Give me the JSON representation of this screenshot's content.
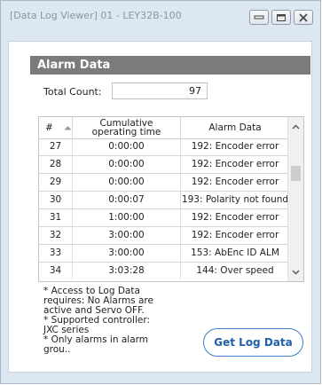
{
  "window": {
    "title": "[Data Log Viewer] 01 - LEY32B-100"
  },
  "section": {
    "title": "Alarm Data"
  },
  "total": {
    "label": "Total Count:",
    "value": "97"
  },
  "table": {
    "columns": [
      "#",
      "Cumulative operating time",
      "Alarm Data"
    ],
    "rows": [
      {
        "num": "27",
        "time": "0:00:00",
        "alarm": "192: Encoder error"
      },
      {
        "num": "28",
        "time": "0:00:00",
        "alarm": "192: Encoder error"
      },
      {
        "num": "29",
        "time": "0:00:00",
        "alarm": "192: Encoder error"
      },
      {
        "num": "30",
        "time": "0:00:07",
        "alarm": "193: Polarity not found"
      },
      {
        "num": "31",
        "time": "1:00:00",
        "alarm": "192: Encoder error"
      },
      {
        "num": "32",
        "time": "3:00:00",
        "alarm": "192: Encoder error"
      },
      {
        "num": "33",
        "time": "3:00:00",
        "alarm": "153: AbEnc ID ALM"
      },
      {
        "num": "34",
        "time": "3:03:28",
        "alarm": "144: Over speed"
      }
    ]
  },
  "notes": [
    "* Access to Log Data requires: No Alarms are active and Servo OFF.",
    "* Supported controller: JXC series",
    "* Only alarms in alarm grou.."
  ],
  "buttons": {
    "get_log": "Get Log Data"
  },
  "icons": {
    "minimize": "minimize-icon",
    "maximize": "maximize-icon",
    "close": "close-icon",
    "sort": "sort-up-icon",
    "scroll_up": "chevron-up-icon",
    "scroll_down": "chevron-down-icon"
  }
}
